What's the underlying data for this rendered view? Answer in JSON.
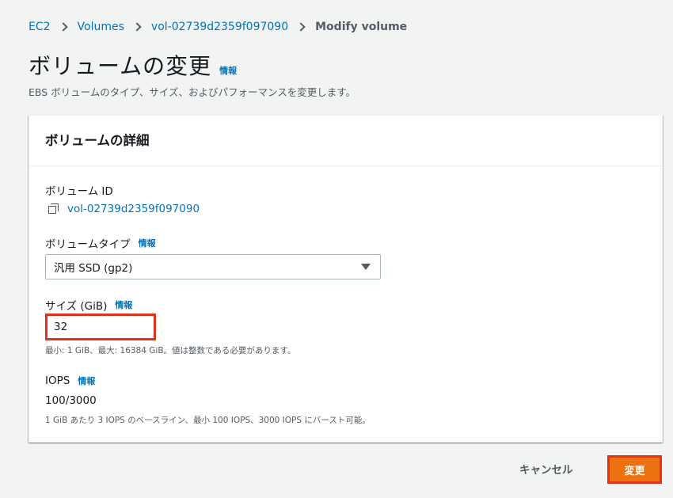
{
  "breadcrumb": {
    "items": [
      "EC2",
      "Volumes",
      "vol-02739d2359f097090"
    ],
    "current": "Modify volume"
  },
  "header": {
    "title": "ボリュームの変更",
    "info_label": "情報",
    "description": "EBS ボリュームのタイプ、サイズ、およびパフォーマンスを変更します。"
  },
  "panel": {
    "title": "ボリュームの詳細",
    "volume_id": {
      "label": "ボリューム ID",
      "value": "vol-02739d2359f097090",
      "icon": "copy-icon"
    },
    "volume_type": {
      "label": "ボリュームタイプ",
      "info_label": "情報",
      "selected": "汎用 SSD (gp2)"
    },
    "size": {
      "label": "サイズ (GiB)",
      "info_label": "情報",
      "value": "32",
      "hint": "最小: 1 GiB、最大: 16384 GiB。値は整数である必要があります。"
    },
    "iops": {
      "label": "IOPS",
      "info_label": "情報",
      "value": "100/3000",
      "hint": "1 GiB あたり 3 IOPS のベースライン、最小 100 IOPS、3000 IOPS にバースト可能。"
    }
  },
  "footer": {
    "cancel_label": "キャンセル",
    "submit_label": "変更"
  },
  "colors": {
    "link": "#0073bb",
    "primary_button": "#ec7211",
    "highlight_border": "#e2321c",
    "background": "#f2f3f3"
  }
}
